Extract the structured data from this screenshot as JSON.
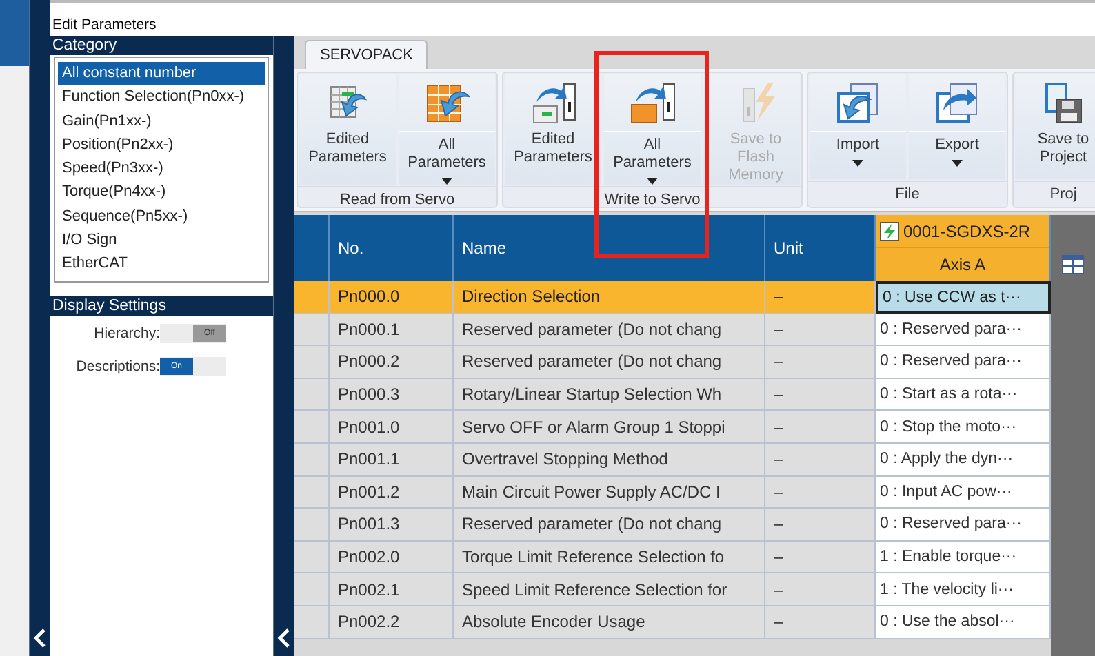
{
  "window": {
    "title": "Edit Parameters"
  },
  "category": {
    "title": "Category",
    "items": [
      {
        "label": "All constant number",
        "selected": true
      },
      {
        "label": "Function Selection(Pn0xx-)",
        "selected": false
      },
      {
        "label": "Gain(Pn1xx-)",
        "selected": false
      },
      {
        "label": "Position(Pn2xx-)",
        "selected": false
      },
      {
        "label": "Speed(Pn3xx-)",
        "selected": false
      },
      {
        "label": "Torque(Pn4xx-)",
        "selected": false
      },
      {
        "label": "Sequence(Pn5xx-)",
        "selected": false
      },
      {
        "label": "I/O Sign",
        "selected": false
      },
      {
        "label": "EtherCAT",
        "selected": false
      }
    ]
  },
  "display_settings": {
    "title": "Display Settings",
    "toggles": [
      {
        "label": "Hierarchy:",
        "on": false,
        "state_text": "Off"
      },
      {
        "label": "Descriptions:",
        "on": true,
        "state_text": "On"
      }
    ]
  },
  "tabs": [
    {
      "label": "SERVOPACK",
      "selected": true
    }
  ],
  "ribbon": {
    "groups": [
      {
        "label": "Read from Servo",
        "buttons": [
          {
            "kind": "read-edited",
            "label": "Edited Parameters",
            "dropdown": false,
            "disabled": false
          },
          {
            "kind": "read-all",
            "label": "All Parameters",
            "dropdown": true,
            "disabled": false
          }
        ]
      },
      {
        "label": "Write to Servo",
        "buttons": [
          {
            "kind": "write-edited",
            "label": "Edited Parameters",
            "dropdown": false,
            "disabled": false
          },
          {
            "kind": "write-all",
            "label": "All Parameters",
            "dropdown": true,
            "disabled": false
          },
          {
            "kind": "flash",
            "label": "Save to Flash Memory",
            "dropdown": false,
            "disabled": true
          }
        ]
      },
      {
        "label": "File",
        "buttons": [
          {
            "kind": "import",
            "label": "Import",
            "dropdown": true,
            "disabled": false
          },
          {
            "kind": "export",
            "label": "Export",
            "dropdown": true,
            "disabled": false
          }
        ]
      },
      {
        "label": "Proj",
        "buttons": [
          {
            "kind": "save",
            "label": "Save to Project",
            "dropdown": false,
            "disabled": false
          }
        ]
      }
    ]
  },
  "table": {
    "columns": [
      "No.",
      "Name",
      "Unit"
    ],
    "device": "0001-SGDXS-2R",
    "axis": "Axis A",
    "rows": [
      {
        "no": "Pn000.0",
        "name": "Direction Selection",
        "unit": "–",
        "value": "0 : Use CCW as t···",
        "selected": true
      },
      {
        "no": "Pn000.1",
        "name": "Reserved parameter (Do not chang",
        "unit": "–",
        "value": "0 : Reserved para···",
        "selected": false
      },
      {
        "no": "Pn000.2",
        "name": "Reserved parameter (Do not chang",
        "unit": "–",
        "value": "0 : Reserved para···",
        "selected": false
      },
      {
        "no": "Pn000.3",
        "name": "Rotary/Linear Startup Selection Wh",
        "unit": "–",
        "value": "0 : Start as a rota···",
        "selected": false
      },
      {
        "no": "Pn001.0",
        "name": "Servo OFF or Alarm Group 1 Stoppi",
        "unit": "–",
        "value": "0 : Stop the moto···",
        "selected": false
      },
      {
        "no": "Pn001.1",
        "name": "Overtravel Stopping Method",
        "unit": "–",
        "value": "0 : Apply the dyn···",
        "selected": false
      },
      {
        "no": "Pn001.2",
        "name": "Main Circuit Power Supply AC/DC I",
        "unit": "–",
        "value": "0 : Input AC pow···",
        "selected": false
      },
      {
        "no": "Pn001.3",
        "name": "Reserved parameter (Do not chang",
        "unit": "–",
        "value": "0 : Reserved para···",
        "selected": false
      },
      {
        "no": "Pn002.0",
        "name": "Torque Limit Reference Selection fo",
        "unit": "–",
        "value": "1 : Enable torque···",
        "selected": false
      },
      {
        "no": "Pn002.1",
        "name": "Speed Limit Reference Selection for",
        "unit": "–",
        "value": "1 : The velocity li···",
        "selected": false
      },
      {
        "no": "Pn002.2",
        "name": "Absolute Encoder Usage",
        "unit": "–",
        "value": "0 : Use the absol···",
        "selected": false
      }
    ]
  }
}
